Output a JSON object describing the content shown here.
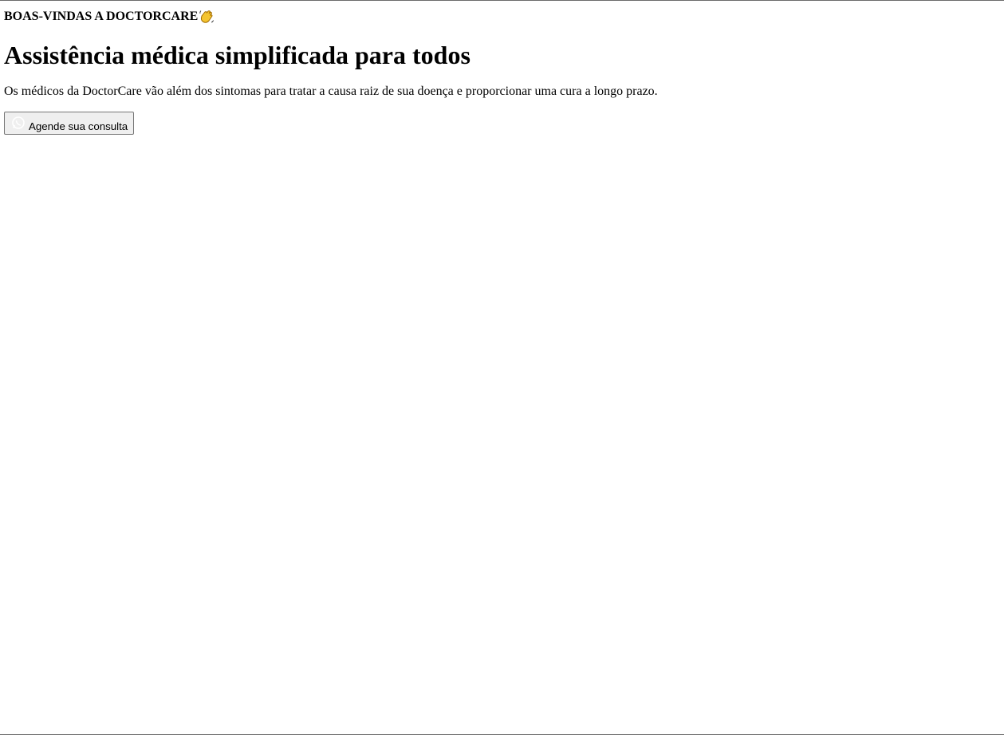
{
  "hero": {
    "eyebrow": "BOAS-VINDAS A DOCTORCARE",
    "eyebrow_icon": "waving-hand-icon",
    "title": "Assistência médica simplificada para todos",
    "description": "Os médicos da DoctorCare vão além dos sintomas para tratar a causa raiz de sua doença e proporcionar uma cura a longo prazo.",
    "cta": {
      "label": "Agende sua consulta",
      "icon": "whatsapp-icon"
    }
  },
  "colors": {
    "text": "#000000",
    "button_bg": "#efefef",
    "button_border": "#767676",
    "wave_emoji": "#f4c430"
  }
}
